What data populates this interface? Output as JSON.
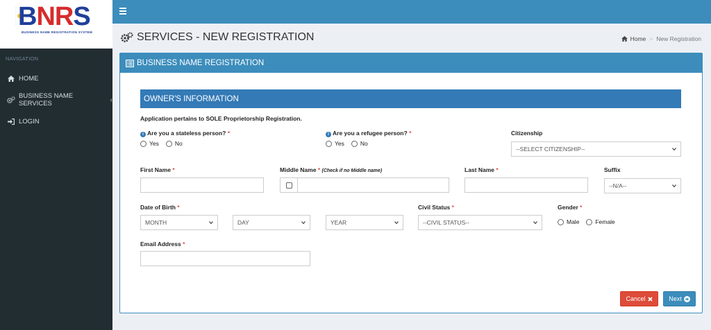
{
  "sidebar": {
    "logo": {
      "letters": [
        "B",
        "N",
        "R",
        "S"
      ],
      "subtitle": "BUSINESS NAME REGISTRATION SYSTEM"
    },
    "nav_header": "NAVIGATION",
    "items": [
      {
        "label": "HOME",
        "icon": "home-icon"
      },
      {
        "label": "BUSINESS NAME SERVICES",
        "icon": "cogs-icon",
        "chevron": "‹"
      },
      {
        "label": "LOGIN",
        "icon": "sign-in-icon"
      }
    ]
  },
  "header": {
    "title": "SERVICES - NEW REGISTRATION",
    "breadcrumb": {
      "home": "Home",
      "separator": ">",
      "current": "New Registration"
    }
  },
  "box": {
    "title": "BUSINESS NAME REGISTRATION",
    "section_title": "OWNER'S INFORMATION",
    "note": "Application pertains to SOLE Proprietorship Registration."
  },
  "form": {
    "stateless": {
      "label": "Are you a stateless person?",
      "required": "*",
      "options": [
        "Yes",
        "No"
      ]
    },
    "refugee": {
      "label": "Are you a refugee person?",
      "required": "*",
      "options": [
        "Yes",
        "No"
      ]
    },
    "citizenship": {
      "label": "Citizenship",
      "selected": "--SELECT CITIZENSHIP--"
    },
    "first_name": {
      "label": "First Name",
      "required": "*",
      "value": ""
    },
    "middle_name": {
      "label": "Middle Name",
      "required": "*",
      "hint": "(Check if no Middle name)",
      "value": ""
    },
    "last_name": {
      "label": "Last Name",
      "required": "*",
      "value": ""
    },
    "suffix": {
      "label": "Suffix",
      "selected": "--N/A--"
    },
    "dob": {
      "label": "Date of Birth",
      "required": "*",
      "month": "MONTH",
      "day": "DAY",
      "year": "YEAR"
    },
    "civil_status": {
      "label": "Civil Status",
      "required": "*",
      "selected": "--CIVIL STATUS--"
    },
    "gender": {
      "label": "Gender",
      "required": "*",
      "options": [
        "Male",
        "Female"
      ]
    },
    "email": {
      "label": "Email Address",
      "required": "*",
      "value": ""
    }
  },
  "buttons": {
    "cancel": "Cancel",
    "next": "Next"
  },
  "colors": {
    "primary": "#3c8dbc",
    "section": "#337ab7",
    "sidebar": "#222d32",
    "danger": "#dd4b39",
    "background": "#ecf0f5"
  }
}
